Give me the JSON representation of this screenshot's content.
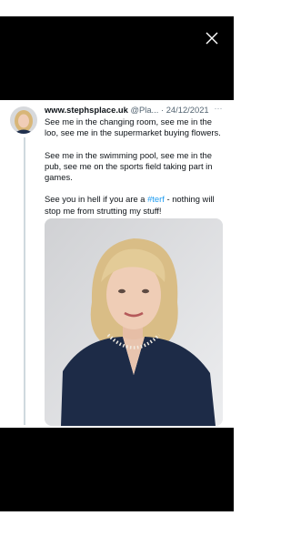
{
  "tweet": {
    "display_name": "www.stephsplace.uk",
    "handle": "@Pla...",
    "separator": "·",
    "date": "24/12/2021",
    "more_label": "···",
    "paragraph_1": "See me in the changing room, see me in the loo, see me in the supermarket buying flowers.",
    "paragraph_2": "See me in the swimming pool, see me in the pub, see me on the sports field taking part in games.",
    "paragraph_3_before": "See you in hell if you are a ",
    "hashtag": "#terf",
    "paragraph_3_after": "  - nothing will stop me from strutting my stuff!"
  },
  "icons": {
    "close": "close-icon",
    "more": "more-icon"
  },
  "colors": {
    "hashtag": "#1d9bf0",
    "overlay": "#000000",
    "thread_line": "#cfd9de"
  }
}
